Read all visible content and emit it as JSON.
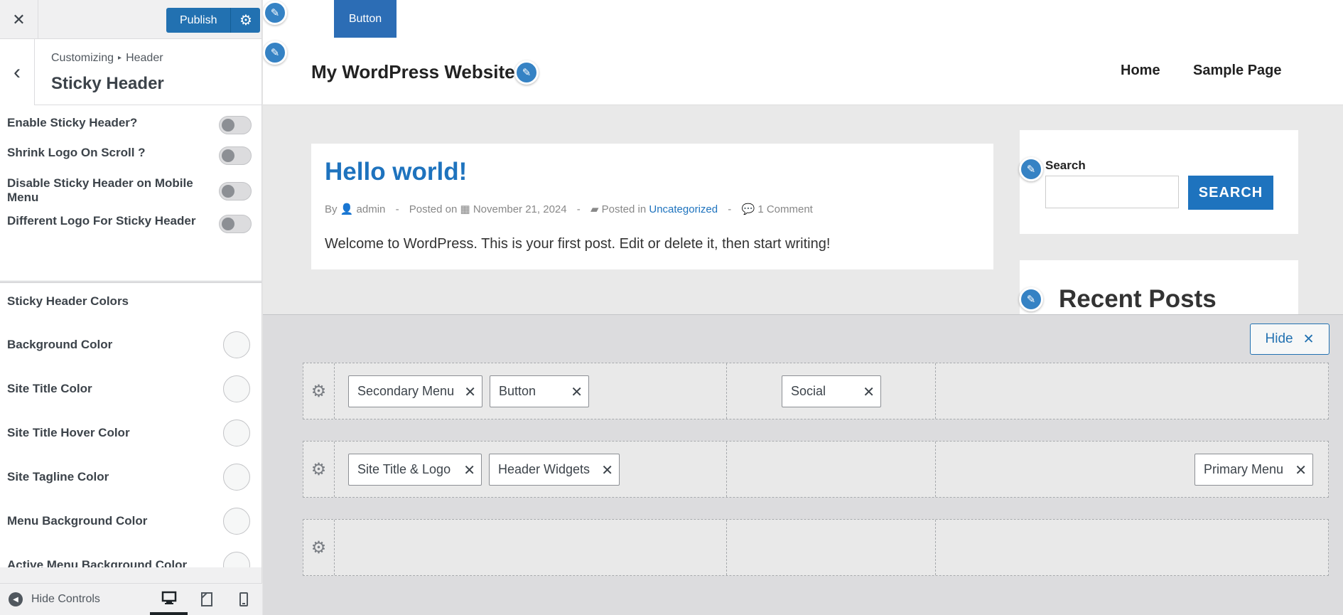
{
  "customizer": {
    "close_icon": "✕",
    "publish_label": "Publish",
    "settings_icon": "⚙",
    "back_icon": "‹",
    "breadcrumb_parent": "Customizing",
    "breadcrumb_separator": "▸",
    "breadcrumb_current": "Header",
    "section_title": "Sticky Header",
    "toggles": [
      {
        "label": "Enable Sticky Header?",
        "on": false
      },
      {
        "label": "Shrink Logo On Scroll ?",
        "on": false
      },
      {
        "label": "Disable Sticky Header on Mobile Menu",
        "on": false
      },
      {
        "label": "Different Logo For Sticky Header",
        "on": false
      }
    ],
    "colors_title": "Sticky Header Colors",
    "color_settings": [
      "Background Color",
      "Site Title Color",
      "Site Title Hover Color",
      "Site Tagline Color",
      "Menu Background Color",
      "Active Menu Background Color"
    ],
    "footer": {
      "hide_controls_label": "Hide Controls",
      "devices": [
        "desktop",
        "tablet",
        "mobile"
      ],
      "active_device": "desktop"
    }
  },
  "preview": {
    "top_button_label": "Button",
    "site_title": "My WordPress Website",
    "nav": [
      "Home",
      "Sample Page"
    ],
    "post": {
      "title": "Hello world!",
      "by_label": "By",
      "author": "admin",
      "posted_on_label": "Posted on",
      "date": "November 21, 2024",
      "posted_in_label": "Posted in",
      "category": "Uncategorized",
      "comments": "1 Comment",
      "excerpt": "Welcome to WordPress. This is your first post. Edit or delete it, then start writing!"
    },
    "search_widget": {
      "label": "Search",
      "button_label": "SEARCH",
      "value": ""
    },
    "recent_posts_title": "Recent Posts",
    "meta_dash": "-"
  },
  "builder": {
    "hide_label": "Hide",
    "hide_icon": "✕",
    "remove_icon": "✕",
    "rows": [
      {
        "items": [
          "Secondary Menu",
          "Button",
          "Social"
        ]
      },
      {
        "items": [
          "Site Title & Logo",
          "Header Widgets",
          "Primary Menu"
        ]
      },
      {
        "items": []
      }
    ]
  },
  "colors": {
    "accent": "#2271b1",
    "link": "#1e73be",
    "pin": "#3582c4"
  }
}
